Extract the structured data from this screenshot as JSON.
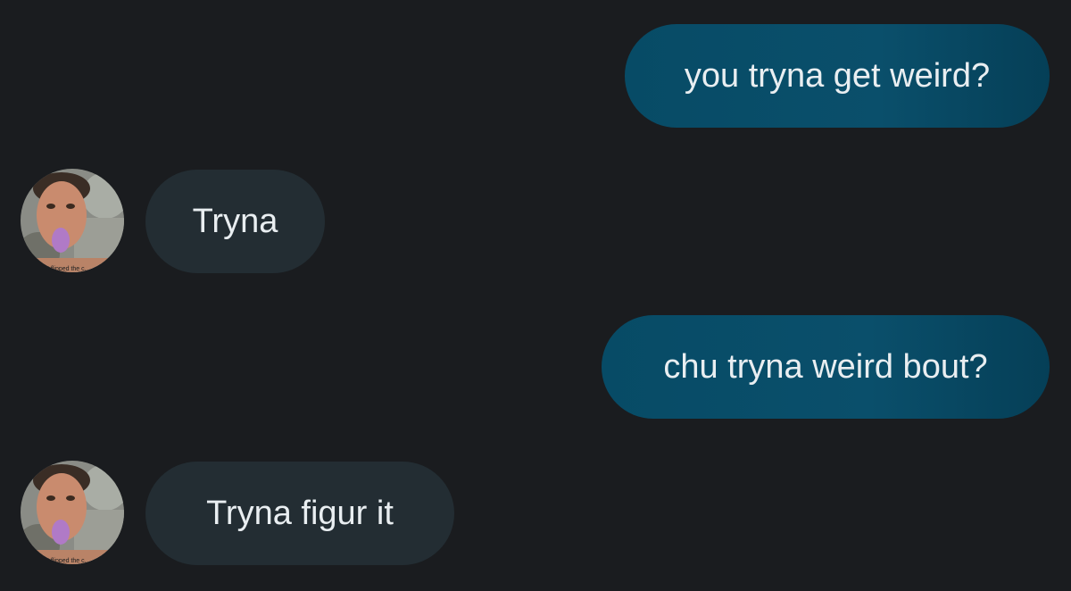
{
  "conversation": {
    "messages": [
      {
        "direction": "sent",
        "text": "you tryna get weird?"
      },
      {
        "direction": "received",
        "text": "Tryna"
      },
      {
        "direction": "sent",
        "text": "chu tryna weird bout?"
      },
      {
        "direction": "received",
        "text": "Tryna figur it"
      }
    ],
    "avatar_caption": "I flipped the c..."
  },
  "colors": {
    "background": "#1a1c1f",
    "sent_bubble": "#0a4f6b",
    "received_bubble": "#232d33",
    "text": "#e9eef1"
  }
}
